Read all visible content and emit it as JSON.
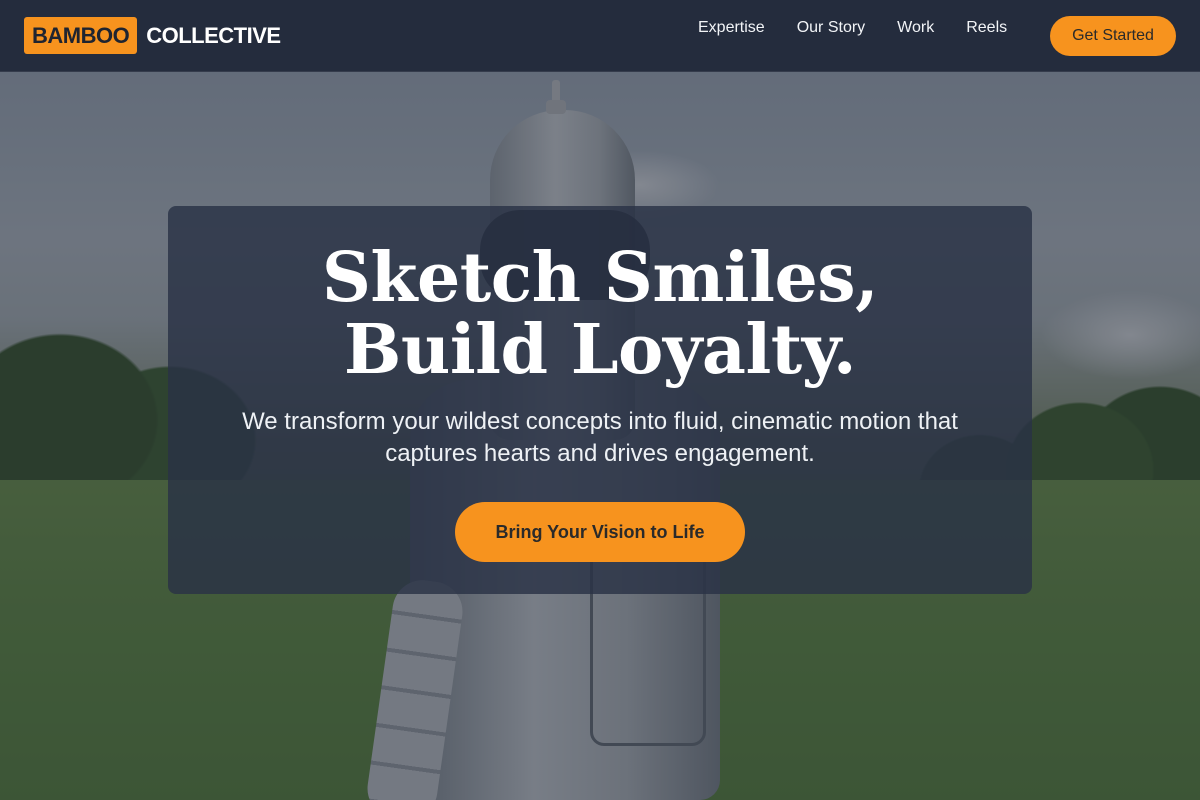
{
  "brand": {
    "highlight": "BAMBOO",
    "rest": "COLLECTIVE"
  },
  "nav": {
    "links": [
      "Expertise",
      "Our Story",
      "Work",
      "Reels"
    ],
    "cta_label": "Get Started"
  },
  "hero": {
    "title": "Sketch Smiles, Build Loyalty.",
    "subtitle": "We transform your wildest concepts into fluid, cinematic motion that captures hearts and drives engagement.",
    "cta_label": "Bring Your Vision to Life"
  },
  "colors": {
    "accent": "#f7931e",
    "nav_bg": "#21293a",
    "card_bg": "#293246"
  }
}
